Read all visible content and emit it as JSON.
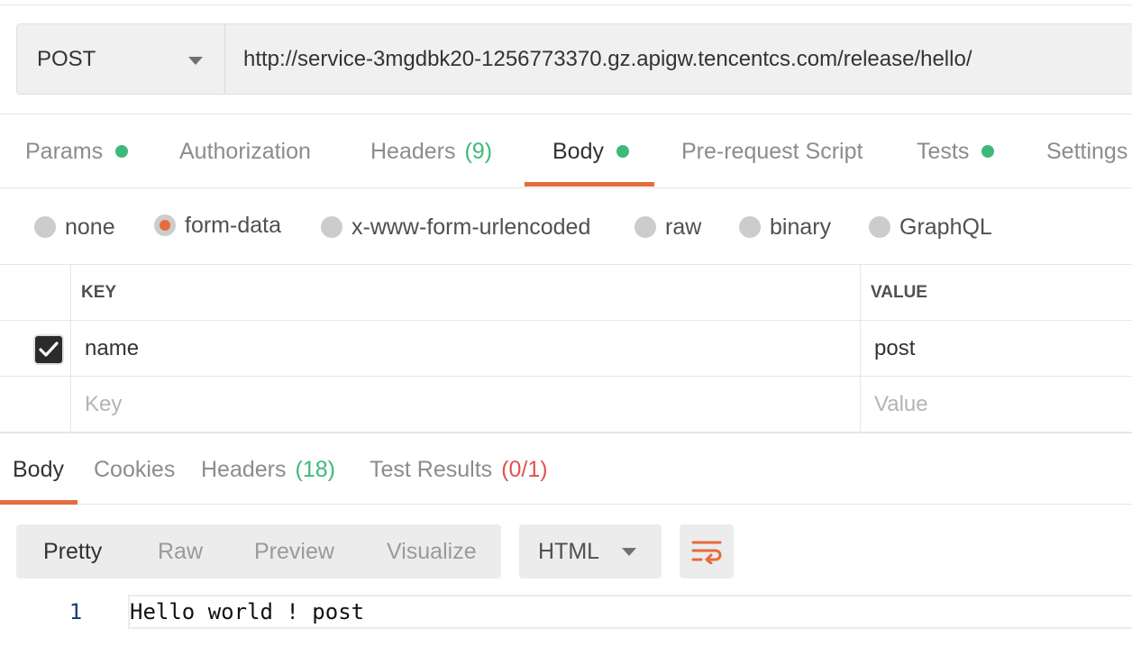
{
  "request": {
    "method": "POST",
    "url": "http://service-3mgdbk20-1256773370.gz.apigw.tencentcs.com/release/hello/"
  },
  "request_tabs": [
    {
      "label": "Params",
      "dot": true
    },
    {
      "label": "Authorization"
    },
    {
      "label": "Headers",
      "count": "(9)"
    },
    {
      "label": "Body",
      "dot": true,
      "active": true
    },
    {
      "label": "Pre-request Script"
    },
    {
      "label": "Tests",
      "dot": true
    },
    {
      "label": "Settings"
    }
  ],
  "body_types": [
    {
      "label": "none",
      "selected": false
    },
    {
      "label": "form-data",
      "selected": true
    },
    {
      "label": "x-www-form-urlencoded",
      "selected": false
    },
    {
      "label": "raw",
      "selected": false
    },
    {
      "label": "binary",
      "selected": false
    },
    {
      "label": "GraphQL",
      "selected": false
    }
  ],
  "form_table": {
    "headers": {
      "key": "KEY",
      "value": "VALUE"
    },
    "rows": [
      {
        "checked": true,
        "key": "name",
        "value": "post"
      }
    ],
    "placeholder": {
      "key": "Key",
      "value": "Value"
    }
  },
  "response_tabs": [
    {
      "label": "Body",
      "active": true
    },
    {
      "label": "Cookies"
    },
    {
      "label": "Headers",
      "count": "(18)"
    },
    {
      "label": "Test Results",
      "count": "(0/1)"
    }
  ],
  "view_modes": [
    "Pretty",
    "Raw",
    "Preview",
    "Visualize"
  ],
  "active_view_mode": "Pretty",
  "format": "HTML",
  "response_body": {
    "line_number": "1",
    "text": "Hello world ! post"
  },
  "colors": {
    "accent": "#e56c3b",
    "dot_green": "#3fb97a",
    "error_red": "#e05252"
  }
}
